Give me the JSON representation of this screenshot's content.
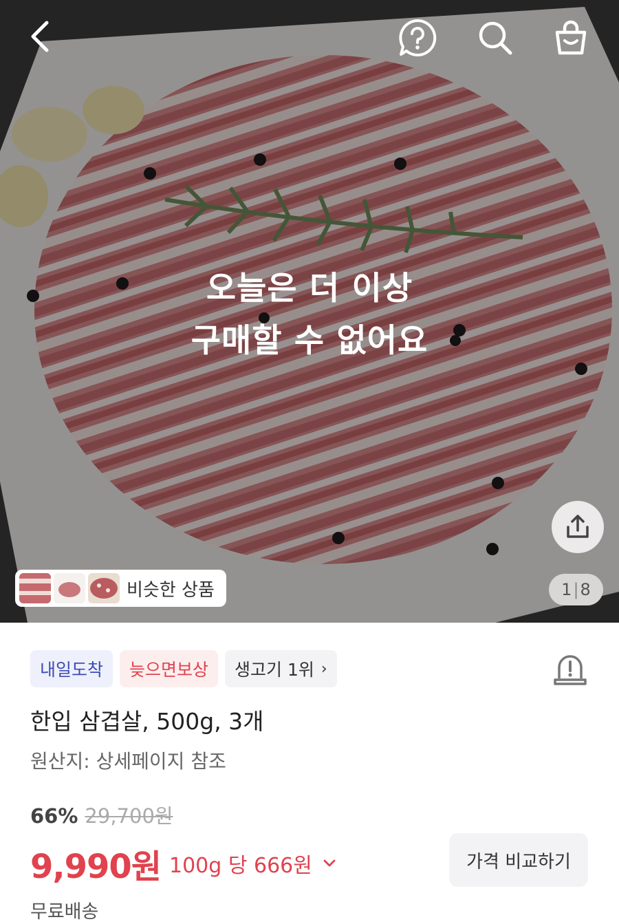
{
  "nav": {
    "back_icon": "chevron-left-icon",
    "help_icon": "question-bubble-icon",
    "search_icon": "search-icon",
    "cart_icon": "shopping-bag-icon"
  },
  "hero": {
    "soldout_line1": "오늘은 더 이상",
    "soldout_line2": "구매할 수 없어요",
    "similar_label": "비슷한 상품",
    "page_current": "1",
    "page_total": "8",
    "share_icon": "share-icon"
  },
  "badges": [
    {
      "label": "내일도착"
    },
    {
      "label": "늦으면보상"
    },
    {
      "label": "생고기 1위"
    }
  ],
  "product": {
    "title": "한입 삼겹살, 500g, 3개",
    "origin": "원산지: 상세페이지 참조",
    "discount": "66%",
    "original_price": "29,700원",
    "sale_price": "9,990원",
    "unit_price": "100g 당 666원",
    "compare_label": "가격 비교하기",
    "shipping": "무료배송"
  },
  "colors": {
    "accent_red": "#e0424e",
    "badge_blue": "#3d4bb5"
  }
}
